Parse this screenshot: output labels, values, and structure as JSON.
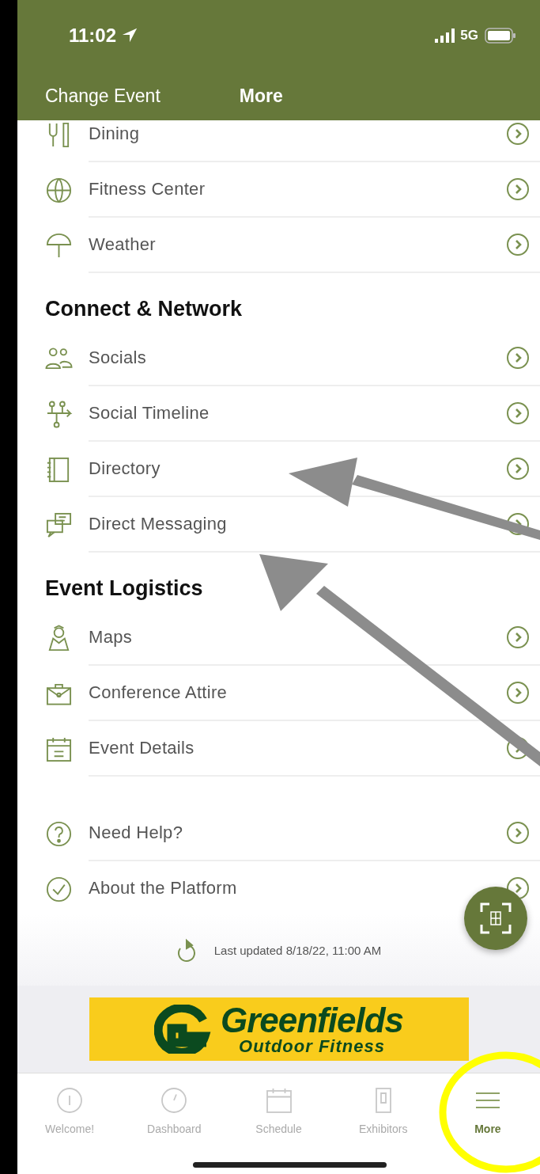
{
  "status_bar": {
    "time": "11:02",
    "network": "5G"
  },
  "nav_bar": {
    "back_link": "Change Event",
    "title": "More"
  },
  "sections": [
    {
      "items": [
        {
          "label": "Dining"
        },
        {
          "label": "Fitness Center"
        },
        {
          "label": "Weather"
        }
      ]
    },
    {
      "heading": "Connect & Network",
      "items": [
        {
          "label": "Socials"
        },
        {
          "label": "Social Timeline"
        },
        {
          "label": "Directory"
        },
        {
          "label": "Direct Messaging"
        }
      ]
    },
    {
      "heading": "Event Logistics",
      "items": [
        {
          "label": "Maps"
        },
        {
          "label": "Conference Attire"
        },
        {
          "label": "Event Details"
        }
      ]
    },
    {
      "items": [
        {
          "label": "Need Help?"
        },
        {
          "label": "About the Platform"
        }
      ]
    }
  ],
  "last_updated": "Last updated 8/18/22, 11:00 AM",
  "banner": {
    "title": "Greenfields",
    "subtitle": "Outdoor Fitness"
  },
  "tab_bar": [
    {
      "label": "Welcome!",
      "selected": false
    },
    {
      "label": "Dashboard",
      "selected": false
    },
    {
      "label": "Schedule",
      "selected": false
    },
    {
      "label": "Exhibitors",
      "selected": false
    },
    {
      "label": "More",
      "selected": true
    }
  ]
}
